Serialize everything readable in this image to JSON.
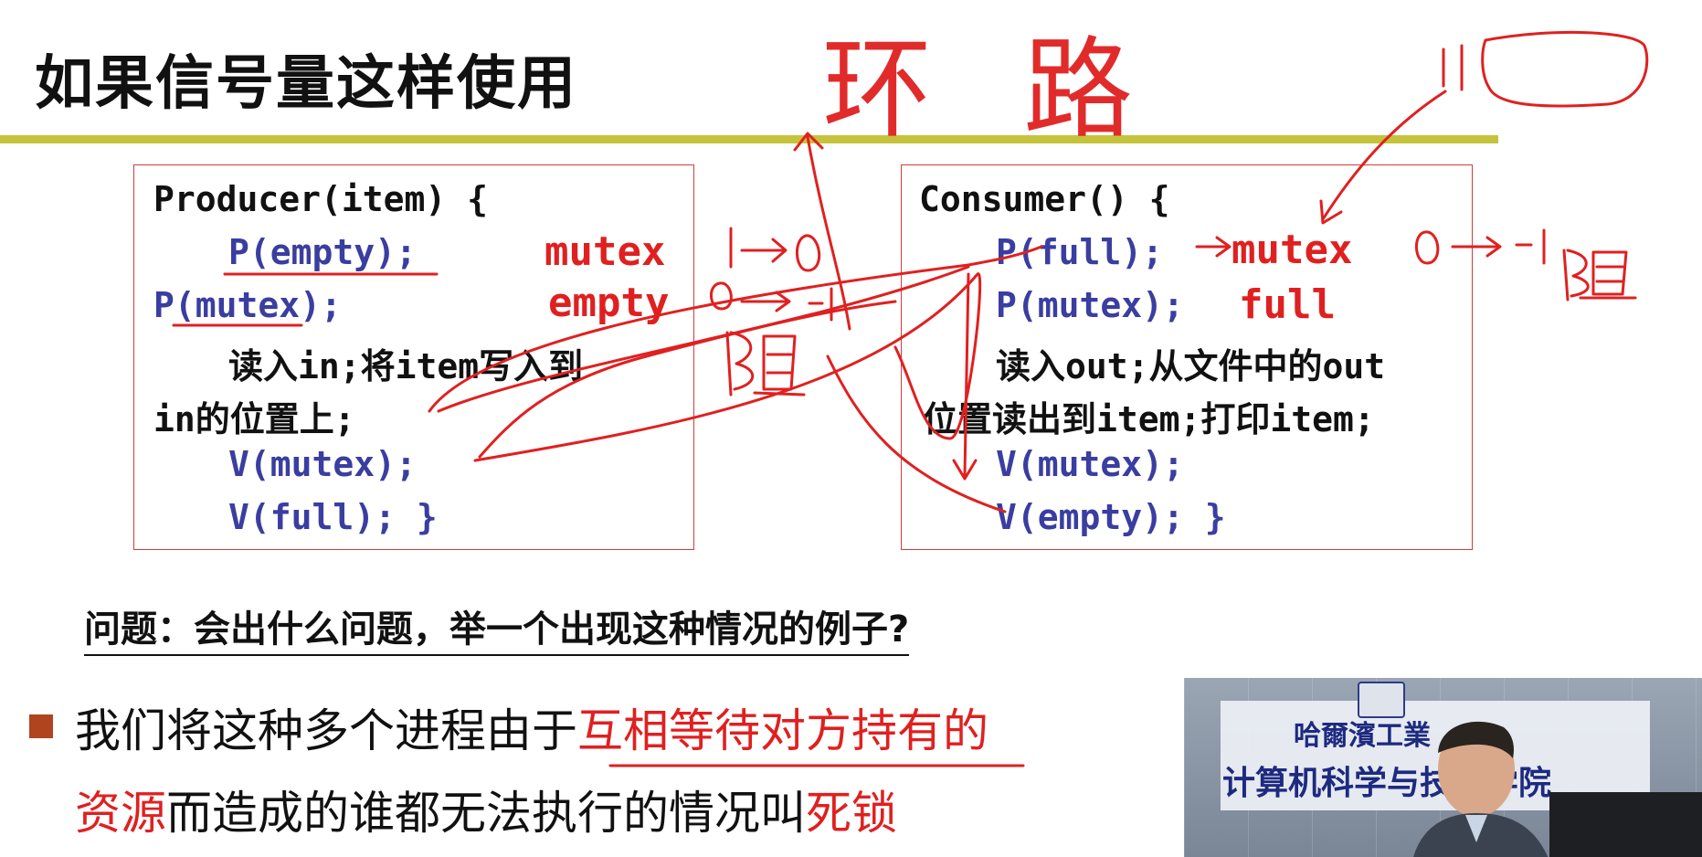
{
  "slide": {
    "title": "如果信号量这样使用"
  },
  "producer": {
    "lines": [
      "Producer(item) {",
      "P(empty);",
      "P(mutex);",
      "读入in;将item写入到",
      "in的位置上;",
      "V(mutex);",
      "V(full); }"
    ]
  },
  "consumer": {
    "lines": [
      "Consumer() {",
      "P(full);",
      "P(mutex);",
      "读入out;从文件中的out",
      "位置读出到item;打印item;",
      "V(mutex);",
      "V(empty); }"
    ]
  },
  "annotations": {
    "mutex_left": "mutex",
    "empty_left": "empty",
    "mutex_right": "mutex",
    "full_right": "full",
    "loop_hand": "环路"
  },
  "question": "问题：会出什么问题，举一个出现这种情况的例子?",
  "statement": {
    "line1_a": "我们将这种多个进程由于",
    "line1_b": "互相等待对方持有的",
    "line2_a": "资源",
    "line2_b": "而造成的谁都无法执行的情况叫",
    "line2_c": "死锁"
  },
  "video": {
    "top_text": "哈爾濱工業",
    "bottom_text": "计算机科学与技术学院"
  },
  "colors": {
    "accent_bar": "#c5c33a",
    "code_blue": "#3a3ea0",
    "ink_red": "#e02020",
    "box_border": "#d23c3c",
    "bullet": "#b0441f"
  }
}
